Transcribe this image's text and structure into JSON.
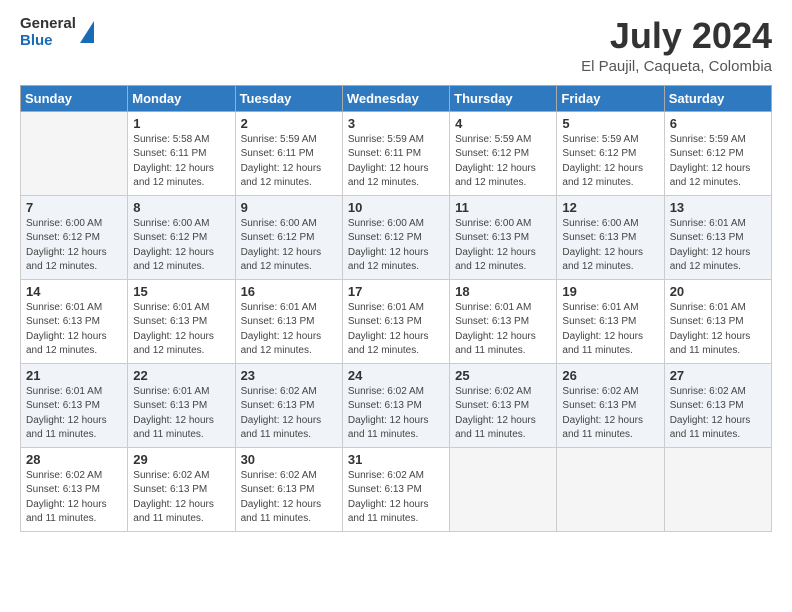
{
  "logo": {
    "line1": "General",
    "line2": "Blue"
  },
  "header": {
    "month_year": "July 2024",
    "location": "El Paujil, Caqueta, Colombia"
  },
  "days_of_week": [
    "Sunday",
    "Monday",
    "Tuesday",
    "Wednesday",
    "Thursday",
    "Friday",
    "Saturday"
  ],
  "weeks": [
    [
      {
        "day": "",
        "sunrise": "",
        "sunset": "",
        "daylight": ""
      },
      {
        "day": "1",
        "sunrise": "Sunrise: 5:58 AM",
        "sunset": "Sunset: 6:11 PM",
        "daylight": "Daylight: 12 hours and 12 minutes."
      },
      {
        "day": "2",
        "sunrise": "Sunrise: 5:59 AM",
        "sunset": "Sunset: 6:11 PM",
        "daylight": "Daylight: 12 hours and 12 minutes."
      },
      {
        "day": "3",
        "sunrise": "Sunrise: 5:59 AM",
        "sunset": "Sunset: 6:11 PM",
        "daylight": "Daylight: 12 hours and 12 minutes."
      },
      {
        "day": "4",
        "sunrise": "Sunrise: 5:59 AM",
        "sunset": "Sunset: 6:12 PM",
        "daylight": "Daylight: 12 hours and 12 minutes."
      },
      {
        "day": "5",
        "sunrise": "Sunrise: 5:59 AM",
        "sunset": "Sunset: 6:12 PM",
        "daylight": "Daylight: 12 hours and 12 minutes."
      },
      {
        "day": "6",
        "sunrise": "Sunrise: 5:59 AM",
        "sunset": "Sunset: 6:12 PM",
        "daylight": "Daylight: 12 hours and 12 minutes."
      }
    ],
    [
      {
        "day": "7",
        "sunrise": "Sunrise: 6:00 AM",
        "sunset": "Sunset: 6:12 PM",
        "daylight": "Daylight: 12 hours and 12 minutes."
      },
      {
        "day": "8",
        "sunrise": "Sunrise: 6:00 AM",
        "sunset": "Sunset: 6:12 PM",
        "daylight": "Daylight: 12 hours and 12 minutes."
      },
      {
        "day": "9",
        "sunrise": "Sunrise: 6:00 AM",
        "sunset": "Sunset: 6:12 PM",
        "daylight": "Daylight: 12 hours and 12 minutes."
      },
      {
        "day": "10",
        "sunrise": "Sunrise: 6:00 AM",
        "sunset": "Sunset: 6:12 PM",
        "daylight": "Daylight: 12 hours and 12 minutes."
      },
      {
        "day": "11",
        "sunrise": "Sunrise: 6:00 AM",
        "sunset": "Sunset: 6:13 PM",
        "daylight": "Daylight: 12 hours and 12 minutes."
      },
      {
        "day": "12",
        "sunrise": "Sunrise: 6:00 AM",
        "sunset": "Sunset: 6:13 PM",
        "daylight": "Daylight: 12 hours and 12 minutes."
      },
      {
        "day": "13",
        "sunrise": "Sunrise: 6:01 AM",
        "sunset": "Sunset: 6:13 PM",
        "daylight": "Daylight: 12 hours and 12 minutes."
      }
    ],
    [
      {
        "day": "14",
        "sunrise": "Sunrise: 6:01 AM",
        "sunset": "Sunset: 6:13 PM",
        "daylight": "Daylight: 12 hours and 12 minutes."
      },
      {
        "day": "15",
        "sunrise": "Sunrise: 6:01 AM",
        "sunset": "Sunset: 6:13 PM",
        "daylight": "Daylight: 12 hours and 12 minutes."
      },
      {
        "day": "16",
        "sunrise": "Sunrise: 6:01 AM",
        "sunset": "Sunset: 6:13 PM",
        "daylight": "Daylight: 12 hours and 12 minutes."
      },
      {
        "day": "17",
        "sunrise": "Sunrise: 6:01 AM",
        "sunset": "Sunset: 6:13 PM",
        "daylight": "Daylight: 12 hours and 12 minutes."
      },
      {
        "day": "18",
        "sunrise": "Sunrise: 6:01 AM",
        "sunset": "Sunset: 6:13 PM",
        "daylight": "Daylight: 12 hours and 11 minutes."
      },
      {
        "day": "19",
        "sunrise": "Sunrise: 6:01 AM",
        "sunset": "Sunset: 6:13 PM",
        "daylight": "Daylight: 12 hours and 11 minutes."
      },
      {
        "day": "20",
        "sunrise": "Sunrise: 6:01 AM",
        "sunset": "Sunset: 6:13 PM",
        "daylight": "Daylight: 12 hours and 11 minutes."
      }
    ],
    [
      {
        "day": "21",
        "sunrise": "Sunrise: 6:01 AM",
        "sunset": "Sunset: 6:13 PM",
        "daylight": "Daylight: 12 hours and 11 minutes."
      },
      {
        "day": "22",
        "sunrise": "Sunrise: 6:01 AM",
        "sunset": "Sunset: 6:13 PM",
        "daylight": "Daylight: 12 hours and 11 minutes."
      },
      {
        "day": "23",
        "sunrise": "Sunrise: 6:02 AM",
        "sunset": "Sunset: 6:13 PM",
        "daylight": "Daylight: 12 hours and 11 minutes."
      },
      {
        "day": "24",
        "sunrise": "Sunrise: 6:02 AM",
        "sunset": "Sunset: 6:13 PM",
        "daylight": "Daylight: 12 hours and 11 minutes."
      },
      {
        "day": "25",
        "sunrise": "Sunrise: 6:02 AM",
        "sunset": "Sunset: 6:13 PM",
        "daylight": "Daylight: 12 hours and 11 minutes."
      },
      {
        "day": "26",
        "sunrise": "Sunrise: 6:02 AM",
        "sunset": "Sunset: 6:13 PM",
        "daylight": "Daylight: 12 hours and 11 minutes."
      },
      {
        "day": "27",
        "sunrise": "Sunrise: 6:02 AM",
        "sunset": "Sunset: 6:13 PM",
        "daylight": "Daylight: 12 hours and 11 minutes."
      }
    ],
    [
      {
        "day": "28",
        "sunrise": "Sunrise: 6:02 AM",
        "sunset": "Sunset: 6:13 PM",
        "daylight": "Daylight: 12 hours and 11 minutes."
      },
      {
        "day": "29",
        "sunrise": "Sunrise: 6:02 AM",
        "sunset": "Sunset: 6:13 PM",
        "daylight": "Daylight: 12 hours and 11 minutes."
      },
      {
        "day": "30",
        "sunrise": "Sunrise: 6:02 AM",
        "sunset": "Sunset: 6:13 PM",
        "daylight": "Daylight: 12 hours and 11 minutes."
      },
      {
        "day": "31",
        "sunrise": "Sunrise: 6:02 AM",
        "sunset": "Sunset: 6:13 PM",
        "daylight": "Daylight: 12 hours and 11 minutes."
      },
      {
        "day": "",
        "sunrise": "",
        "sunset": "",
        "daylight": ""
      },
      {
        "day": "",
        "sunrise": "",
        "sunset": "",
        "daylight": ""
      },
      {
        "day": "",
        "sunrise": "",
        "sunset": "",
        "daylight": ""
      }
    ]
  ]
}
